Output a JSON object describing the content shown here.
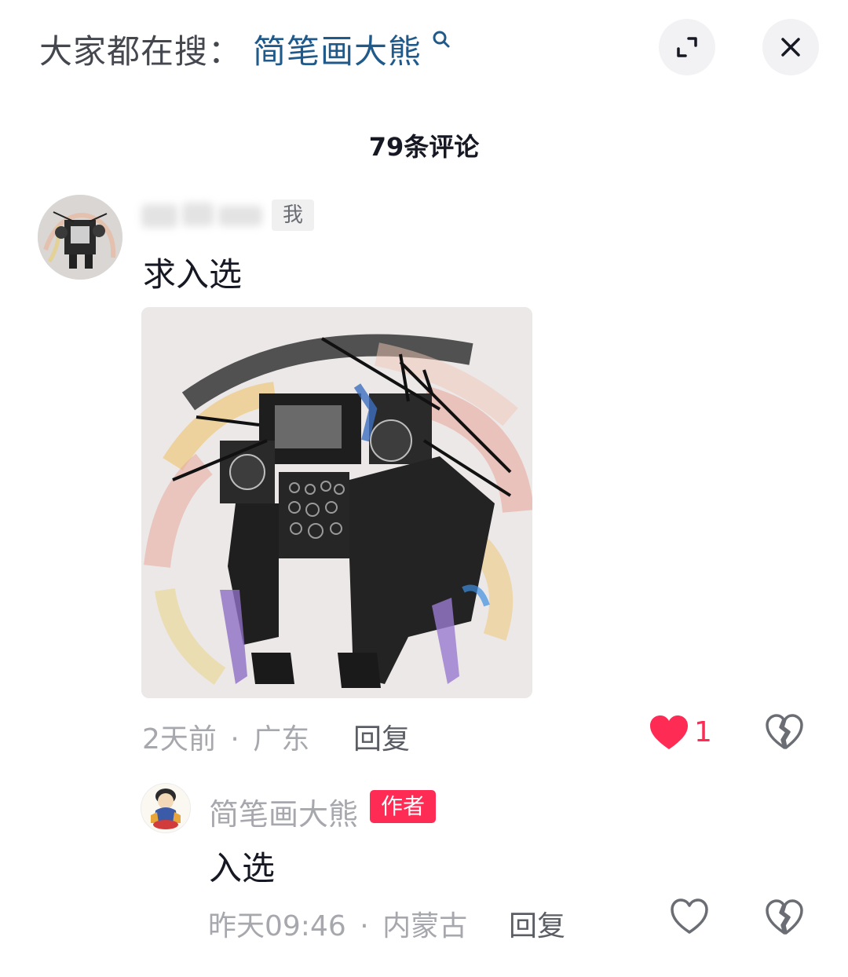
{
  "header": {
    "hot_search_prefix": "大家都在搜：",
    "hot_search_keyword": "简笔画大熊",
    "expand_icon": "expand-icon",
    "close_icon": "close-icon"
  },
  "comments_title": "79条评论",
  "comment": {
    "avatar_icon": "avatar-drawing",
    "me_tag": "我",
    "text": "求入选",
    "image": "drawing-of-robot-with-speakers",
    "time": "2天前",
    "separator": "·",
    "location": "广东",
    "reply_label": "回复",
    "like_count": "1",
    "liked": true,
    "like_icon": "heart-icon",
    "dislike_icon": "broken-heart-icon"
  },
  "reply": {
    "avatar_icon": "avatar-cartoon",
    "username": "简笔画大熊",
    "author_tag": "作者",
    "text": "入选",
    "time": "昨天09:46",
    "separator": "·",
    "location": "内蒙古",
    "reply_label": "回复",
    "liked": false,
    "like_icon": "heart-outline-icon",
    "dislike_icon": "broken-heart-icon"
  },
  "colors": {
    "accent": "#fe2c55",
    "keyword": "#1f5a8a",
    "muted": "#a7a8ad"
  }
}
